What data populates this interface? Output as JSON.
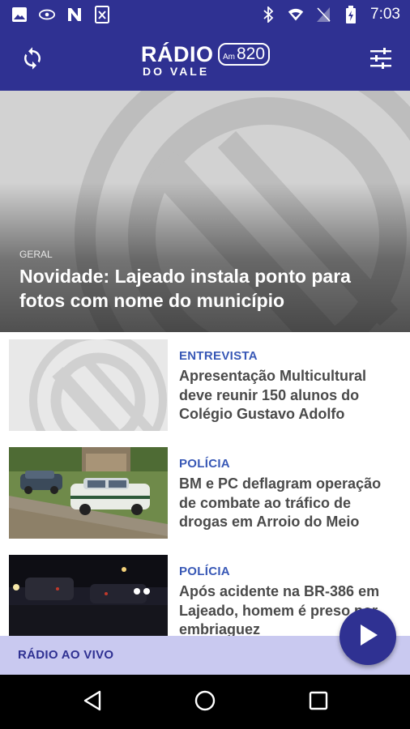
{
  "status_bar": {
    "time": "7:03",
    "left_icons": [
      "image-icon",
      "pocket-icon",
      "n-app-icon",
      "excel-icon"
    ],
    "right_icons": [
      "bluetooth-icon",
      "wifi-icon",
      "no-sim-icon",
      "battery-icon"
    ]
  },
  "app_bar": {
    "logo_text": "RÁDIO",
    "logo_subtext": "DO VALE",
    "logo_band": "Am",
    "logo_frequency": "820",
    "refresh_icon": "refresh-icon",
    "filter_icon": "filter-sliders-icon"
  },
  "featured": {
    "category": "GERAL",
    "title": "Novidade: Lajeado instala ponto para fotos com nome do município"
  },
  "news": [
    {
      "category": "ENTREVISTA",
      "headline": "Apresentação Multicultural deve reunir 150 alunos do Colégio Gustavo Adolfo",
      "thumb": "placeholder-logo"
    },
    {
      "category": "POLÍCIA",
      "headline": "BM e PC deflagram operação de combate ao tráfico de drogas em Arroio do Meio",
      "thumb": "police-cars-photo"
    },
    {
      "category": "POLÍCIA",
      "headline": "Após acidente na BR-386 em Lajeado, homem é preso por embriaguez",
      "thumb": "night-road-photo"
    }
  ],
  "live_bar": {
    "label": "RÁDIO AO VIVO",
    "play_icon": "play-icon"
  },
  "nav_bar": {
    "icons": [
      "back-icon",
      "home-icon",
      "recents-icon"
    ]
  },
  "colors": {
    "primary": "#2f3192",
    "accent_category": "#3858b6",
    "live_bar_bg": "#c9c9f0"
  }
}
